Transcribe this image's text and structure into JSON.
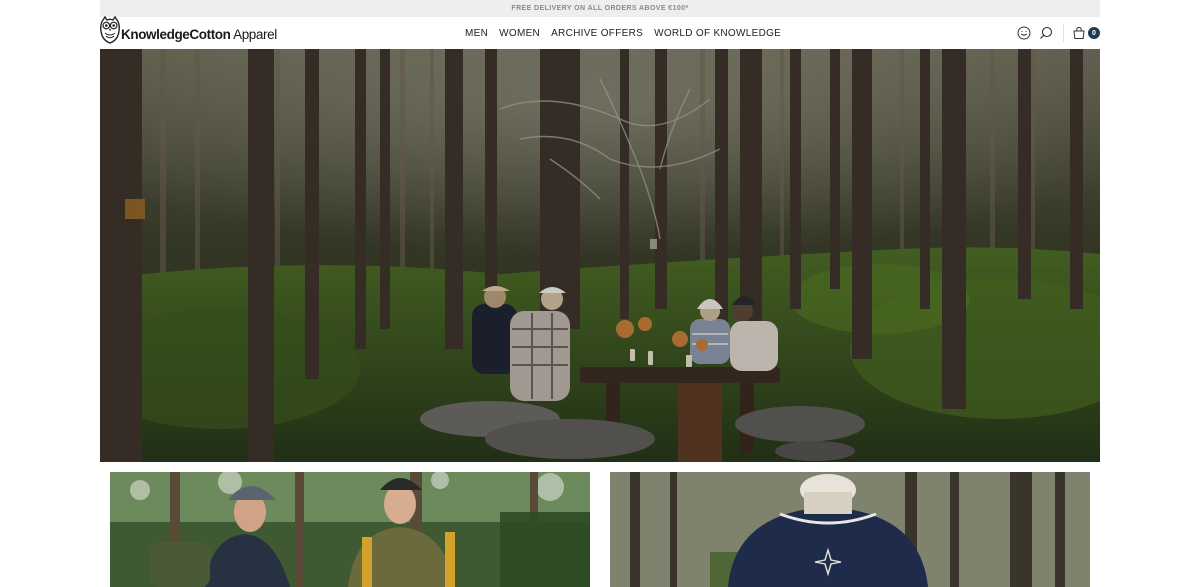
{
  "announcement": {
    "text": "FREE DELIVERY ON ALL ORDERS ABOVE €100*"
  },
  "header": {
    "logo": {
      "brand_bold": "KnowledgeCotton",
      "brand_regular": " Apparel"
    },
    "nav": [
      {
        "label": "MEN"
      },
      {
        "label": "WOMEN"
      },
      {
        "label": "ARCHIVE OFFERS"
      },
      {
        "label": "WORLD OF KNOWLEDGE"
      }
    ],
    "actions": {
      "account_icon": "smiley-face-icon",
      "search_icon": "search-icon",
      "cart_icon": "shopping-bag-icon",
      "cart_count": "0"
    }
  },
  "hero": {
    "image": "forest dinner photo"
  },
  "cards": [
    {
      "image": "two men in forest photo"
    },
    {
      "image": "person in navy sweater photo"
    }
  ],
  "colors": {
    "announcement_bg": "#eeeeee",
    "announcement_text": "#8a8a8a",
    "cart_badge": "#1f3b4d"
  }
}
